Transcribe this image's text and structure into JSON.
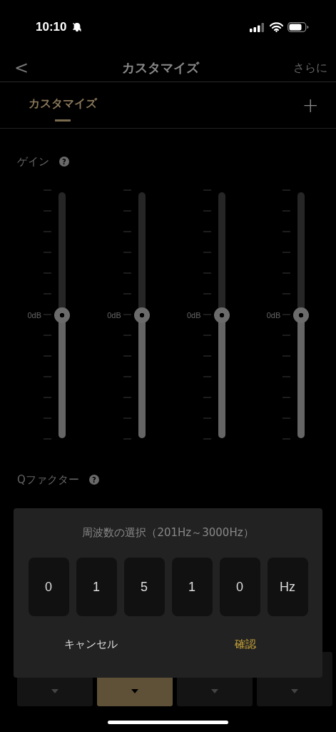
{
  "status_bar": {
    "time": "10:10"
  },
  "nav": {
    "back": "<",
    "title": "カスタマイズ",
    "more": "さらに"
  },
  "tabs": [
    {
      "label": "カスタマイズ",
      "selected": true
    }
  ],
  "add": "+",
  "gain": {
    "label": "ゲイン",
    "help": "?",
    "bands": [
      {
        "reading": "0dB",
        "level": 0.5
      },
      {
        "reading": "0dB",
        "level": 0.5
      },
      {
        "reading": "0dB",
        "level": 0.5
      },
      {
        "reading": "0dB",
        "level": 0.5
      }
    ]
  },
  "q_factor": {
    "label": "Qファクター",
    "help": "?",
    "bands": [
      {
        "selected": false
      },
      {
        "selected": true
      },
      {
        "selected": false
      },
      {
        "selected": false
      }
    ]
  },
  "dialog": {
    "title": "周波数の選択（201Hz～3000Hz）",
    "digits": [
      "0",
      "1",
      "5",
      "1",
      "0"
    ],
    "unit": "Hz",
    "cancel": "キャンセル",
    "confirm": "確認"
  }
}
